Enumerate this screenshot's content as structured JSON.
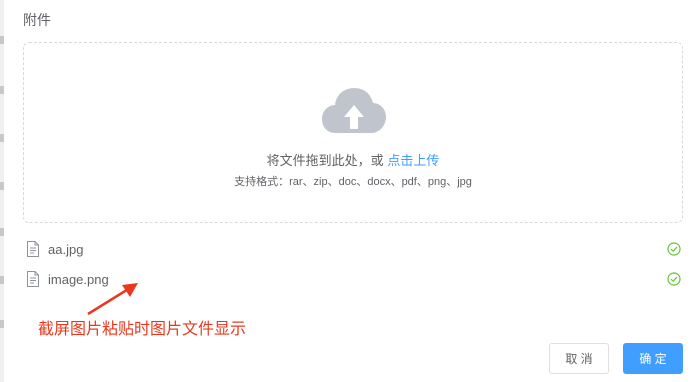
{
  "section": {
    "label": "附件"
  },
  "upload": {
    "prompt_text": "将文件拖到此处，或",
    "link_text": "点击上传",
    "format_tip": "支持格式：rar、zip、doc、docx、pdf、png、jpg",
    "icon": "cloud-upload-icon"
  },
  "files": [
    {
      "name": "aa.jpg",
      "status": "success"
    },
    {
      "name": "image.png",
      "status": "success"
    }
  ],
  "annotation": {
    "text": "截屏图片粘贴时图片文件显示"
  },
  "footer": {
    "cancel_label": "取 消",
    "confirm_label": "确 定"
  },
  "colors": {
    "primary": "#409eff",
    "success": "#67c23a",
    "annotation": "#e8391f",
    "icon_gray": "#c0c4cc"
  }
}
